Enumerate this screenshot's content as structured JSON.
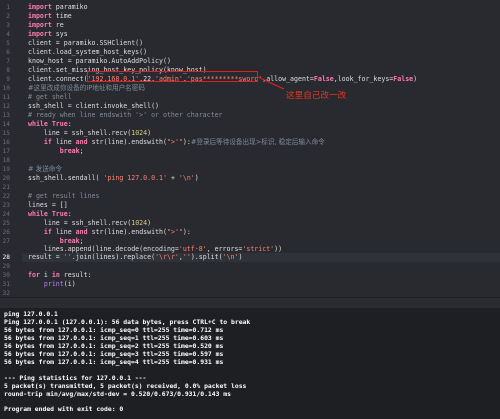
{
  "editor": {
    "line_numbers": [
      "1",
      "2",
      "3",
      "4",
      "5",
      "6",
      "7",
      "8",
      "9",
      "10",
      "11",
      "12",
      "13",
      "14",
      "15",
      "16",
      "17",
      "18",
      "19",
      "20",
      "21",
      "22",
      "23",
      "24",
      "25",
      "26",
      "27",
      "28",
      "29",
      "30",
      "31",
      "32"
    ],
    "lines": {
      "l1_kw": "import",
      "l1_rest": " paramiko",
      "l2_kw": "import",
      "l2_rest": " time",
      "l3_kw": "import",
      "l3_rest": " re",
      "l4_kw": "import",
      "l4_rest": " sys",
      "l5": "client = paramiko.SSHClient()",
      "l6": "client.load_system_host_keys()",
      "l7": "know_host = paramiko.AutoAddPolicy()",
      "l8": "client.set_missing_host_key_policy(know_host)",
      "l9_a": "client.connect(",
      "l9_s1": "'192.168.0.1'",
      "l9_b": ",22,",
      "l9_s2": "'admin'",
      "l9_c": ",",
      "l9_s3": "'pas*********sword'",
      "l9_d": ",allow_agent=",
      "l9_k1": "False",
      "l9_e": ",look_for_keys=",
      "l9_k2": "False",
      "l9_f": ")",
      "l10": "#这里改成你设备的IP地址和用户名密码",
      "l11": "# get shell",
      "l12": "ssh_shell = client.invoke_shell()",
      "l13": "# ready when line endswith '>' or other character",
      "l14_kw": "while",
      "l14_k2": " True",
      "l14_rest": ":",
      "l15_a": "    line = ssh_shell.recv(",
      "l15_n": "1024",
      "l15_b": ")",
      "l16_a": "    ",
      "l16_kw": "if",
      "l16_b": " line ",
      "l16_kw2": "and",
      "l16_c": " str(line).endswith(",
      "l16_s": "\">'\"",
      "l16_d": "):",
      "l16_cm": "#登录后等待设备出现>标识, 稳定后输入命令",
      "l17_kw": "        break",
      "l17_rest": ";",
      "l18": "",
      "l19": "# 发送命令",
      "l20_a": "ssh_shell.sendall( ",
      "l20_s1": "'ping 127.0.0.1'",
      "l20_b": " + ",
      "l20_s2": "'\\n'",
      "l20_c": ")",
      "l21": "",
      "l22": "# get result lines",
      "l23": "lines = []",
      "l24_kw": "while",
      "l24_k2": " True",
      "l24_rest": ":",
      "l25_a": "    line = ssh_shell.recv(",
      "l25_n": "1024",
      "l25_b": ")",
      "l26_a": "    ",
      "l26_kw": "if",
      "l26_b": " line ",
      "l26_kw2": "and",
      "l26_c": " str(line).endswith(",
      "l26_s": "\">'\"",
      "l26_d": "):",
      "l27_kw": "        break",
      "l27_rest": ";",
      "l28_a": "    lines.append(line.decode(encoding=",
      "l28_s1": "'utf-8'",
      "l28_b": ", errors=",
      "l28_s2": "'strict'",
      "l28_c": "))",
      "l29_a": "result = ",
      "l29_s1": "''",
      "l29_b": ".join(lines).replace(",
      "l29_s2": "'\\r\\r'",
      "l29_c": ",",
      "l29_s3": "''",
      "l29_d": ").split(",
      "l29_s4": "'\\n'",
      "l29_e": ")",
      "l30": "",
      "l31_kw": "for",
      "l31_a": " i ",
      "l31_kw2": "in",
      "l31_b": " result:",
      "l32_a": "    ",
      "l32_bi": "print",
      "l32_b": "(i)"
    }
  },
  "annotation": {
    "text": "这里自己改一改"
  },
  "console": {
    "lines": [
      "ping 127.0.0.1",
      "Ping 127.0.0.1 (127.0.0.1): 56 data bytes, press CTRL+C to break",
      "56 bytes from 127.0.0.1: icmp_seq=0 ttl=255 time=0.712 ms",
      "56 bytes from 127.0.0.1: icmp_seq=1 ttl=255 time=0.603 ms",
      "56 bytes from 127.0.0.1: icmp_seq=2 ttl=255 time=0.520 ms",
      "56 bytes from 127.0.0.1: icmp_seq=3 ttl=255 time=0.597 ms",
      "56 bytes from 127.0.0.1: icmp_seq=4 ttl=255 time=0.931 ms",
      "",
      "--- Ping statistics for 127.0.0.1 ---",
      "5 packet(s) transmitted, 5 packet(s) received, 0.0% packet loss",
      "round-trip min/avg/max/std-dev = 0.520/0.673/0.931/0.143 ms",
      "",
      "Program ended with exit code: 0"
    ]
  },
  "colors": {
    "editor_bg": "#292a30",
    "console_bg": "#1e1f23",
    "keyword": "#ff7ab2",
    "string": "#ff8170",
    "comment": "#7f8c98",
    "annotation_red": "#e02020"
  }
}
